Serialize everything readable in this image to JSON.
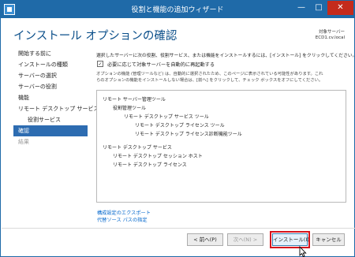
{
  "window": {
    "title": "役割と機能の追加ウィザード",
    "minimize_glyph": "—",
    "maximize_glyph": "□",
    "close_glyph": "✕"
  },
  "header": {
    "page_title": "インストール オプションの確認",
    "target_label": "対象サーバー",
    "target_server": "ECD1.cv.local"
  },
  "sidebar": {
    "items": [
      {
        "label": "開始する前に",
        "state": "normal"
      },
      {
        "label": "インストールの種類",
        "state": "normal"
      },
      {
        "label": "サーバーの選択",
        "state": "normal"
      },
      {
        "label": "サーバーの役割",
        "state": "normal"
      },
      {
        "label": "機能",
        "state": "normal"
      },
      {
        "label": "リモート デスクトップ サービス",
        "state": "normal"
      },
      {
        "label": "役割サービス",
        "state": "indent"
      },
      {
        "label": "確認",
        "state": "active"
      },
      {
        "label": "結果",
        "state": "disabled"
      }
    ]
  },
  "main": {
    "description": "選択したサーバーに次の役割、役割サービス、または機能をインストールするには、[インストール] をクリックしてください。",
    "restart_checkbox": {
      "checked": true,
      "check_glyph": "✓",
      "label": "必要に応じて対象サーバーを自動的に再起動する"
    },
    "info_line1": "オプションの機能 (管理ツールなど) は、自動的に選択されたため、このページに表示されている可能性があります。これ",
    "info_line2": "らのオプションの機能をインストールしない場合は、[前へ] をクリックして、チェック ボックスをオフにしてください。",
    "features": [
      {
        "label": "リモート サーバー管理ツール",
        "level": 0
      },
      {
        "label": "役割管理ツール",
        "level": 1
      },
      {
        "label": "リモート デスクトップ サービス ツール",
        "level": 2
      },
      {
        "label": "リモート デスクトップ ライセンス ツール",
        "level": 3
      },
      {
        "label": "リモート デスクトップ ライセンス診断機能ツール",
        "level": 3
      },
      {
        "label": "リモート デスクトップ サービス",
        "level": 0
      },
      {
        "label": "リモート デスクトップ セッション ホスト",
        "level": 1
      },
      {
        "label": "リモート デスクトップ ライセンス",
        "level": 1
      }
    ],
    "export_link": "構成設定のエクスポート",
    "alt_source_link": "代替ソース パスの指定"
  },
  "footer": {
    "prev_label": "< 前へ(P)",
    "next_label": "次へ(N) >",
    "install_label": "インストール(I)",
    "cancel_label": "キャンセル"
  },
  "colors": {
    "titlebar": "#1f6aa8",
    "title_text": "#0b4f8a",
    "active_nav": "#2d6cb1",
    "link": "#0066cc",
    "highlight": "#d6141d"
  }
}
